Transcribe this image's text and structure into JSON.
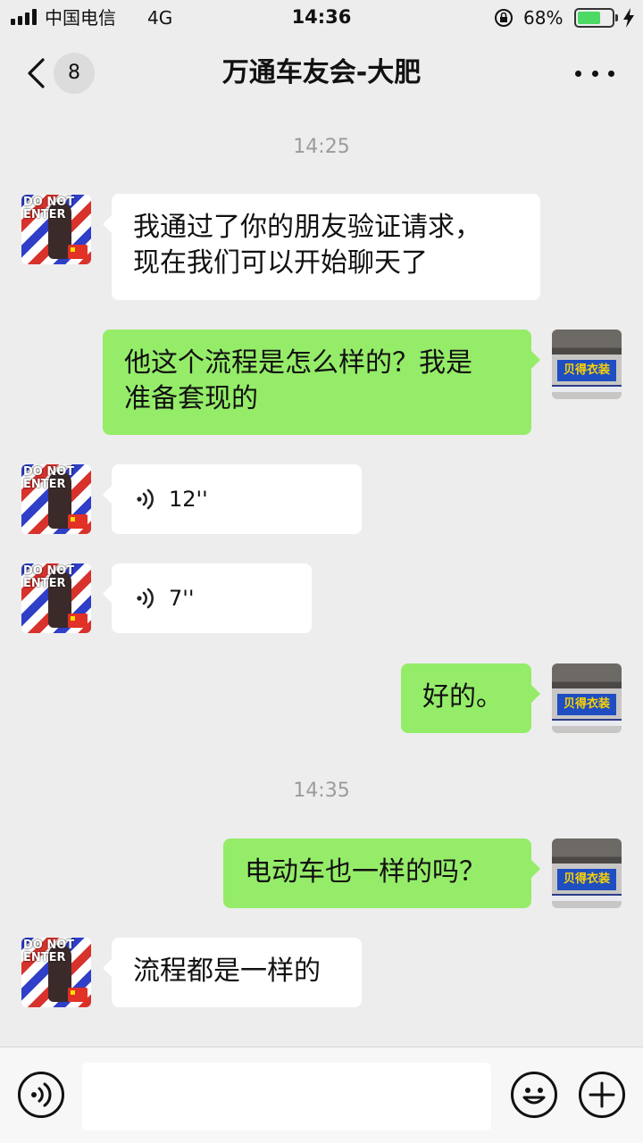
{
  "status_bar": {
    "carrier": "中国电信",
    "network": "4G",
    "time": "14:36",
    "battery_percent": "68%",
    "battery_level": 0.68,
    "icons": [
      "signal-icon",
      "orientation-lock-icon",
      "battery-icon",
      "charging-icon"
    ]
  },
  "nav": {
    "back_count": "8",
    "title": "万通车友会-大肥",
    "icons": [
      "chevron-left-icon",
      "more-icon"
    ]
  },
  "messages": [
    {
      "type": "time",
      "text": "14:25"
    },
    {
      "type": "text",
      "side": "left",
      "line1": "我通过了你的朋友验证请求，",
      "line2": "现在我们可以开始聊天了"
    },
    {
      "type": "text",
      "side": "right",
      "line1": "他这个流程是怎么样的？我是",
      "line2": "准备套现的"
    },
    {
      "type": "voice",
      "side": "left",
      "duration": "12''"
    },
    {
      "type": "voice",
      "side": "left",
      "duration": "7''"
    },
    {
      "type": "text",
      "side": "right",
      "text": "好的。"
    },
    {
      "type": "time",
      "text": "14:35"
    },
    {
      "type": "text",
      "side": "right",
      "text": "电动车也一样的吗？"
    },
    {
      "type": "text",
      "side": "left",
      "text": "流程都是一样的"
    }
  ],
  "avatar_left_text": "DO NOT ENTER",
  "avatar_right_text": "贝得衣装",
  "input_bar": {
    "placeholder": "",
    "icons": [
      "voice-input-icon",
      "emoji-icon",
      "plus-icon"
    ]
  },
  "colors": {
    "background": "#ededed",
    "outgoing_bubble": "#95ec69",
    "incoming_bubble": "#ffffff",
    "battery_fill": "#4cd964"
  }
}
